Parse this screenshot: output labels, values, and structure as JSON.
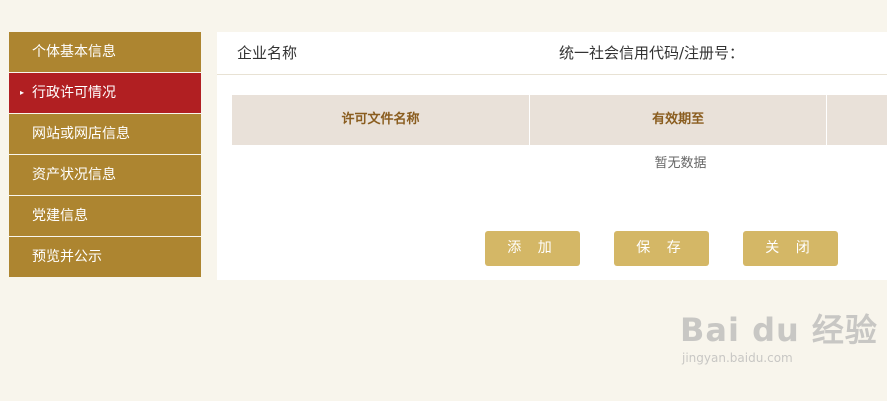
{
  "sidebar": {
    "items": [
      {
        "label": "个体基本信息"
      },
      {
        "label": "行政许可情况",
        "marker": "▸"
      },
      {
        "label": "网站或网店信息"
      },
      {
        "label": "资产状况信息"
      },
      {
        "label": "党建信息"
      },
      {
        "label": "预览并公示"
      }
    ]
  },
  "header": {
    "company_label": "企业名称",
    "credit_code_label": "统一社会信用代码/注册号："
  },
  "table": {
    "columns": [
      "许可文件名称",
      "有效期至"
    ],
    "empty_text": "暂无数据"
  },
  "buttons": {
    "add": "添 加",
    "save": "保 存",
    "close": "关 闭"
  },
  "colors": {
    "sidebar_bg": "#ad8530",
    "sidebar_active_bg": "#b11f22",
    "button_bg": "#d4b766",
    "table_header_bg": "#e9e1d9",
    "page_bg": "#f8f5ec"
  },
  "watermark": {
    "logo": "Bai du 经验",
    "url": "jingyan.baidu.com"
  }
}
